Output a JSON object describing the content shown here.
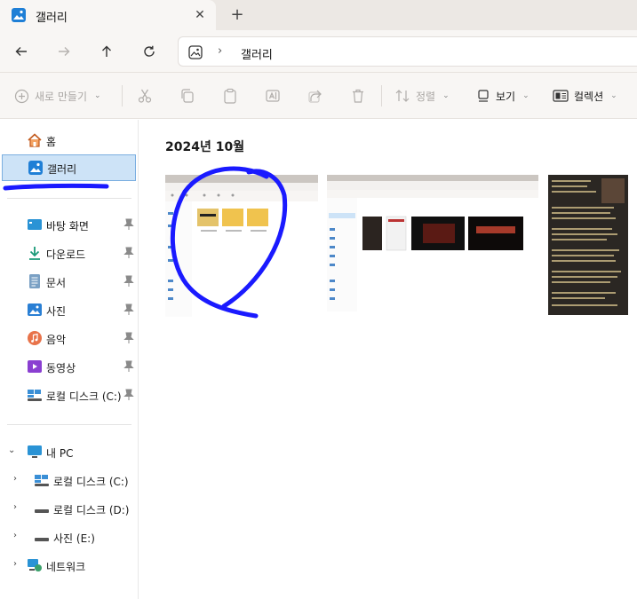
{
  "tab": {
    "title": "갤러리",
    "close_glyph": "✕",
    "add_glyph": "+"
  },
  "nav": {
    "breadcrumb": "갤러리",
    "separator": "›"
  },
  "commands": {
    "new": "새로 만들기",
    "sort": "정렬",
    "view": "보기",
    "collection": "컬렉션"
  },
  "sidebar": {
    "quick": [
      {
        "label": "홈",
        "icon": "home-icon"
      },
      {
        "label": "갤러리",
        "icon": "gallery-icon",
        "selected": true
      }
    ],
    "pinned": [
      {
        "label": "바탕 화면",
        "icon": "desktop-icon"
      },
      {
        "label": "다운로드",
        "icon": "download-icon"
      },
      {
        "label": "문서",
        "icon": "document-icon"
      },
      {
        "label": "사진",
        "icon": "pictures-icon"
      },
      {
        "label": "음악",
        "icon": "music-icon"
      },
      {
        "label": "동영상",
        "icon": "video-icon"
      },
      {
        "label": "로컬 디스크 (C:)",
        "icon": "drive-icon"
      }
    ],
    "pc": {
      "label": "내 PC",
      "icon": "pc-icon"
    },
    "drives": [
      {
        "label": "로컬 디스크 (C:)",
        "icon": "windows-drive-icon"
      },
      {
        "label": "로컬 디스크 (D:)",
        "icon": "drive-icon"
      },
      {
        "label": "사진 (E:)",
        "icon": "drive-icon"
      }
    ],
    "network": {
      "label": "네트워크",
      "icon": "network-icon"
    }
  },
  "main": {
    "group_title": "2024년 10월"
  },
  "colors": {
    "accent": "#0067c0",
    "annotation": "#1a1aff",
    "selected_bg": "#cde3f7"
  }
}
